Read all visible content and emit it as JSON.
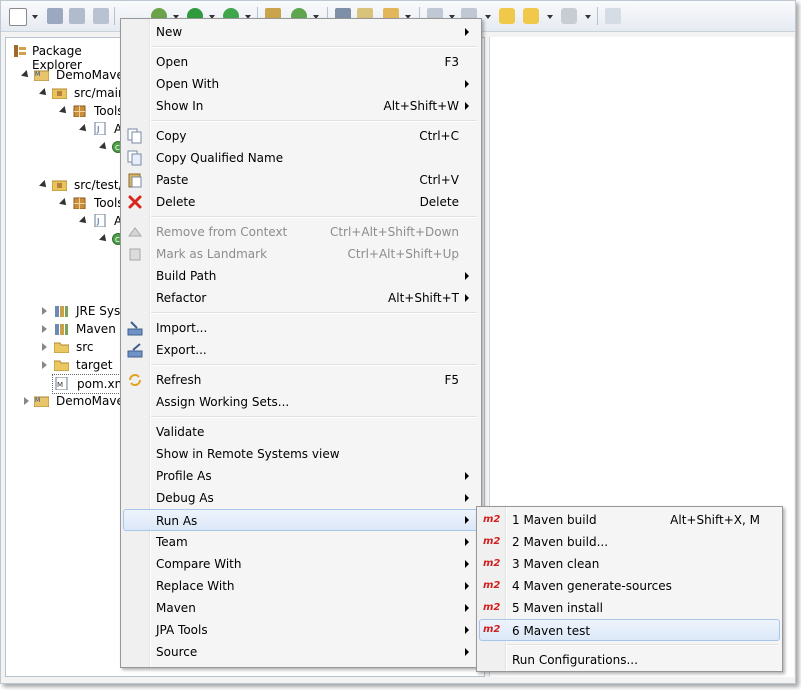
{
  "explorer": {
    "title": "Package Explorer",
    "tree": [
      {
        "label": "DemoMaven",
        "icon": "maven-project-icon"
      },
      {
        "label": "src/main",
        "icon": "source-folder-icon"
      },
      {
        "label": "Tools",
        "icon": "package-icon"
      },
      {
        "label": "A",
        "icon": "java-file-icon"
      },
      {
        "label": "src/test/j",
        "icon": "source-folder-icon"
      },
      {
        "label": "Tools",
        "icon": "package-icon"
      },
      {
        "label": "A",
        "icon": "java-file-icon"
      },
      {
        "label": "JRE Syste",
        "icon": "library-icon"
      },
      {
        "label": "Maven D",
        "icon": "library-icon"
      },
      {
        "label": "src",
        "icon": "folder-icon"
      },
      {
        "label": "target",
        "icon": "folder-icon"
      },
      {
        "label": "pom.xml",
        "icon": "pom-file-icon"
      },
      {
        "label": "DemoMaven",
        "icon": "maven-project-icon"
      }
    ]
  },
  "context_menu": {
    "items": [
      {
        "label": "New",
        "accel": ""
      },
      {
        "label": "Open",
        "accel": "F3"
      },
      {
        "label": "Open With",
        "accel": ""
      },
      {
        "label": "Show In",
        "accel": "Alt+Shift+W"
      },
      {
        "label": "Copy",
        "accel": "Ctrl+C"
      },
      {
        "label": "Copy Qualified Name",
        "accel": ""
      },
      {
        "label": "Paste",
        "accel": "Ctrl+V"
      },
      {
        "label": "Delete",
        "accel": "Delete"
      },
      {
        "label": "Remove from Context",
        "accel": "Ctrl+Alt+Shift+Down"
      },
      {
        "label": "Mark as Landmark",
        "accel": "Ctrl+Alt+Shift+Up"
      },
      {
        "label": "Build Path",
        "accel": ""
      },
      {
        "label": "Refactor",
        "accel": "Alt+Shift+T"
      },
      {
        "label": "Import...",
        "accel": ""
      },
      {
        "label": "Export...",
        "accel": ""
      },
      {
        "label": "Refresh",
        "accel": "F5"
      },
      {
        "label": "Assign Working Sets...",
        "accel": ""
      },
      {
        "label": "Validate",
        "accel": ""
      },
      {
        "label": "Show in Remote Systems view",
        "accel": ""
      },
      {
        "label": "Profile As",
        "accel": ""
      },
      {
        "label": "Debug As",
        "accel": ""
      },
      {
        "label": "Run As",
        "accel": ""
      },
      {
        "label": "Team",
        "accel": ""
      },
      {
        "label": "Compare With",
        "accel": ""
      },
      {
        "label": "Replace With",
        "accel": ""
      },
      {
        "label": "Maven",
        "accel": ""
      },
      {
        "label": "JPA Tools",
        "accel": ""
      },
      {
        "label": "Source",
        "accel": ""
      }
    ]
  },
  "submenu": {
    "badge": "m2",
    "items": [
      {
        "label": "1 Maven build",
        "accel": "Alt+Shift+X, M"
      },
      {
        "label": "2 Maven build...",
        "accel": ""
      },
      {
        "label": "3 Maven clean",
        "accel": ""
      },
      {
        "label": "4 Maven generate-sources",
        "accel": ""
      },
      {
        "label": "5 Maven install",
        "accel": ""
      },
      {
        "label": "6 Maven test",
        "accel": ""
      },
      {
        "label": "Run Configurations...",
        "accel": ""
      }
    ]
  },
  "colors": {
    "highlight_border": "#a8c5ea",
    "m2_badge": "#d21f1f",
    "delete_icon": "#d9261c"
  }
}
